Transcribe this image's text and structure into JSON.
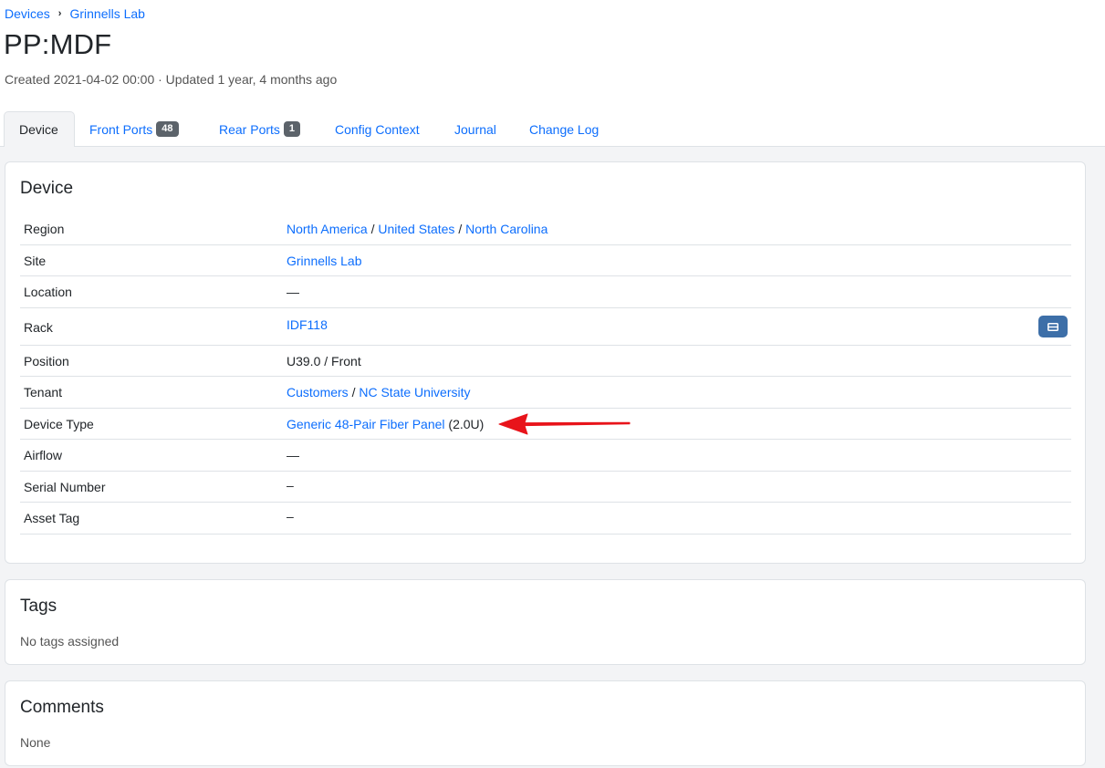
{
  "breadcrumb": {
    "items": [
      "Devices",
      "Grinnells Lab"
    ],
    "separator": "›"
  },
  "page": {
    "title": "PP:MDF",
    "meta": "Created 2021-04-02 00:00 · Updated 1 year, 4 months ago"
  },
  "tabs": [
    {
      "label": "Device",
      "active": true
    },
    {
      "label": "Front Ports",
      "badge": "48"
    },
    {
      "label": "Rear Ports",
      "badge": "1"
    },
    {
      "label": "Config Context"
    },
    {
      "label": "Journal"
    },
    {
      "label": "Change Log"
    }
  ],
  "device_card": {
    "title": "Device",
    "rows": {
      "region": {
        "label": "Region",
        "links": [
          "North America",
          "United States",
          "North Carolina"
        ],
        "sep": "/"
      },
      "site": {
        "label": "Site",
        "value": "Grinnells Lab"
      },
      "location": {
        "label": "Location",
        "value": "—"
      },
      "rack": {
        "label": "Rack",
        "value": "IDF118"
      },
      "position": {
        "label": "Position",
        "value": "U39.0 / Front"
      },
      "tenant": {
        "label": "Tenant",
        "links": [
          "Customers",
          "NC State University"
        ],
        "sep": "/"
      },
      "device_type": {
        "label": "Device Type",
        "link": "Generic 48-Pair Fiber Panel",
        "suffix": "(2.0U)"
      },
      "airflow": {
        "label": "Airflow",
        "value": "—"
      },
      "serial": {
        "label": "Serial Number",
        "value": "–"
      },
      "asset_tag": {
        "label": "Asset Tag",
        "value": "–"
      }
    }
  },
  "tags_card": {
    "title": "Tags",
    "text": "No tags assigned"
  },
  "comments_card": {
    "title": "Comments",
    "text": "None"
  },
  "colors": {
    "link": "#0d6efd",
    "accent_button": "#3d6fa8",
    "annotation_arrow": "#e8141b",
    "badge": "#5c636a"
  },
  "icons": {
    "rack_button": "rack-elevation-icon",
    "annotation": "red-arrow"
  }
}
